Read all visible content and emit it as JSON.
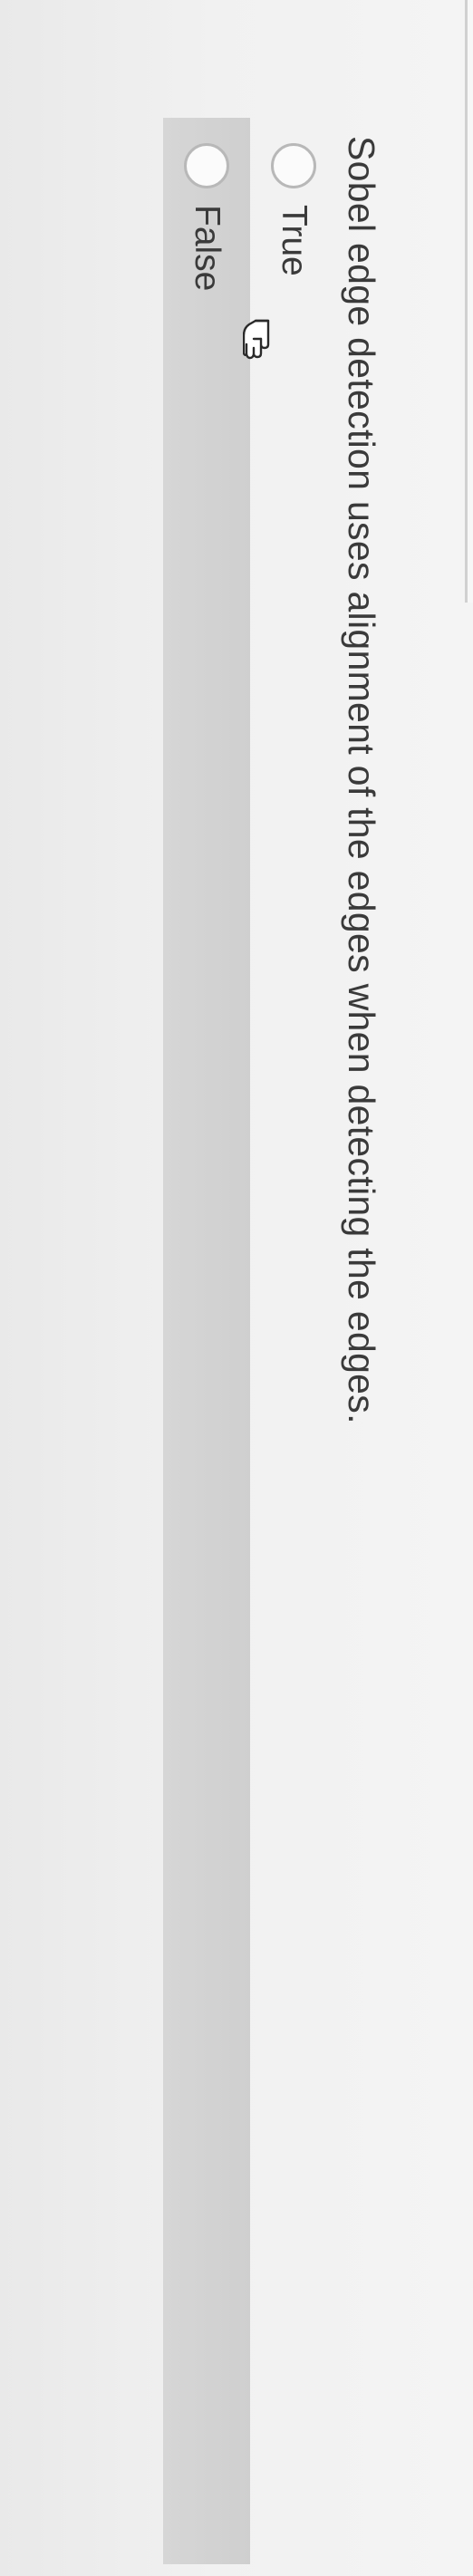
{
  "question": {
    "text": "Sobel edge detection uses alignment of the edges when detecting the edges."
  },
  "options": [
    {
      "label": "True",
      "selected": false
    },
    {
      "label": "False",
      "selected": false,
      "highlighted": true
    }
  ],
  "cursor": {
    "icon": "pointer-hand-icon"
  },
  "colors": {
    "page_background": "#f2f2f2",
    "highlight_row": "#d2d2d2",
    "text": "#3a3a3a",
    "radio_border": "#b8b8b8"
  }
}
